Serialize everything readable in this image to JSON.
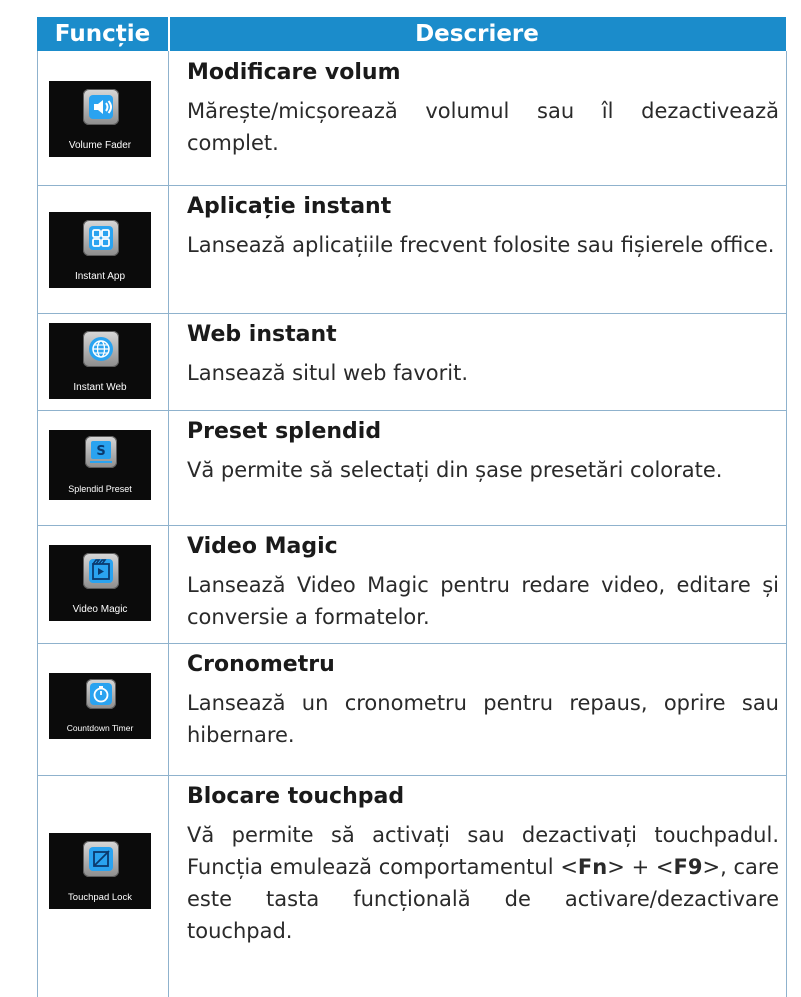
{
  "header": {
    "col_function": "Funcție",
    "col_description": "Descriere"
  },
  "rows": [
    {
      "icon_label": "Volume Fader",
      "icon": "speaker-icon",
      "title": "Modificare volum",
      "text": "Mărește/micșorează volumul sau îl dezactivează complet."
    },
    {
      "icon_label": "Instant App",
      "icon": "app-grid-icon",
      "title": "Aplicație instant",
      "text": "Lansează aplicațiile frecvent folosite sau fișierele office."
    },
    {
      "icon_label": "Instant Web",
      "icon": "globe-icon",
      "title": "Web instant",
      "text": "Lansează situl web favorit."
    },
    {
      "icon_label": "Splendid Preset",
      "icon": "splendid-s-icon",
      "title": "Preset splendid",
      "text": "Vă permite să selectați din șase presetări colorate."
    },
    {
      "icon_label": "Video Magic",
      "icon": "clapperboard-icon",
      "title": "Video Magic",
      "text": "Lansează Video Magic pentru redare video, editare și conversie a formatelor."
    },
    {
      "icon_label": "Countdown Timer",
      "icon": "stopwatch-icon",
      "title": "Cronometru",
      "text": "Lansează un cronometru pentru repaus, oprire sau hibernare."
    },
    {
      "icon_label": "Touchpad Lock",
      "icon": "touchpad-lock-icon",
      "title": "Blocare touchpad",
      "text_a": "Vă permite să activați sau dezactivați touchpadul. Funcția emulează comportamentul <",
      "key1": "Fn",
      "text_b": "> + <",
      "key2": "F9",
      "text_c": ">, care este tasta funcțională de activare/dezactivare touchpad."
    }
  ],
  "colors": {
    "header_bg": "#1b8ccb",
    "grid": "#8fb2cd",
    "icon_accent": "#2aa3f0"
  }
}
